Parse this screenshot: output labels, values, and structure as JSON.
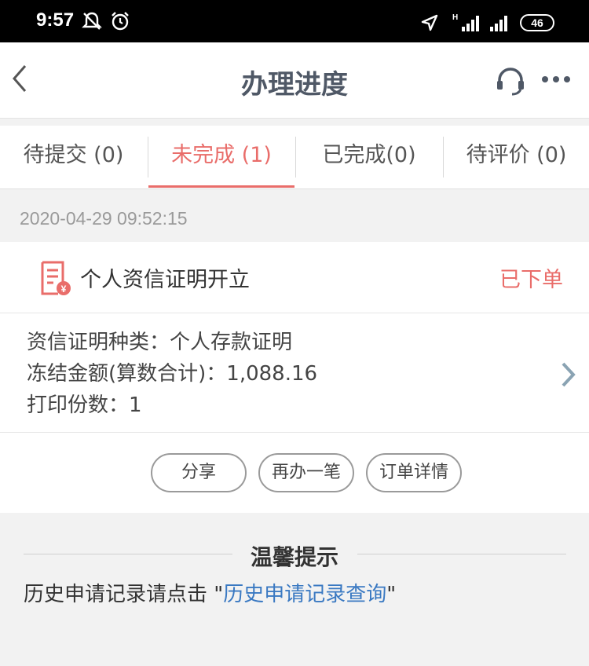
{
  "status_bar": {
    "time": "9:57",
    "battery": "46",
    "icons": [
      "mute-bell-icon",
      "alarm-icon",
      "location-arrow-icon",
      "signal-h-icon",
      "signal-icon",
      "battery-icon"
    ]
  },
  "navbar": {
    "title": "办理进度",
    "icons": [
      "back-icon",
      "headset-icon",
      "more-icon"
    ]
  },
  "tabs": [
    {
      "label": "待提交 (0)",
      "active": false
    },
    {
      "label": "未完成 (1)",
      "active": true
    },
    {
      "label": "已完成(0)",
      "active": false
    },
    {
      "label": "待评价 (0)",
      "active": false
    }
  ],
  "order": {
    "timestamp": "2020-04-29 09:52:15",
    "title": "个人资信证明开立",
    "status": "已下单",
    "details": [
      "资信证明种类：个人存款证明",
      "冻结金额(算数合计)：1,088.16",
      "打印份数：1"
    ],
    "actions": [
      "分享",
      "再办一笔",
      "订单详情"
    ]
  },
  "tips": {
    "title": "温馨提示",
    "text_before": "历史申请记录请点击 \"",
    "link": "历史申请记录查询",
    "text_after": "\""
  },
  "colors": {
    "accent": "#e96d6a",
    "link": "#3a79c2",
    "title": "#4f5866"
  }
}
